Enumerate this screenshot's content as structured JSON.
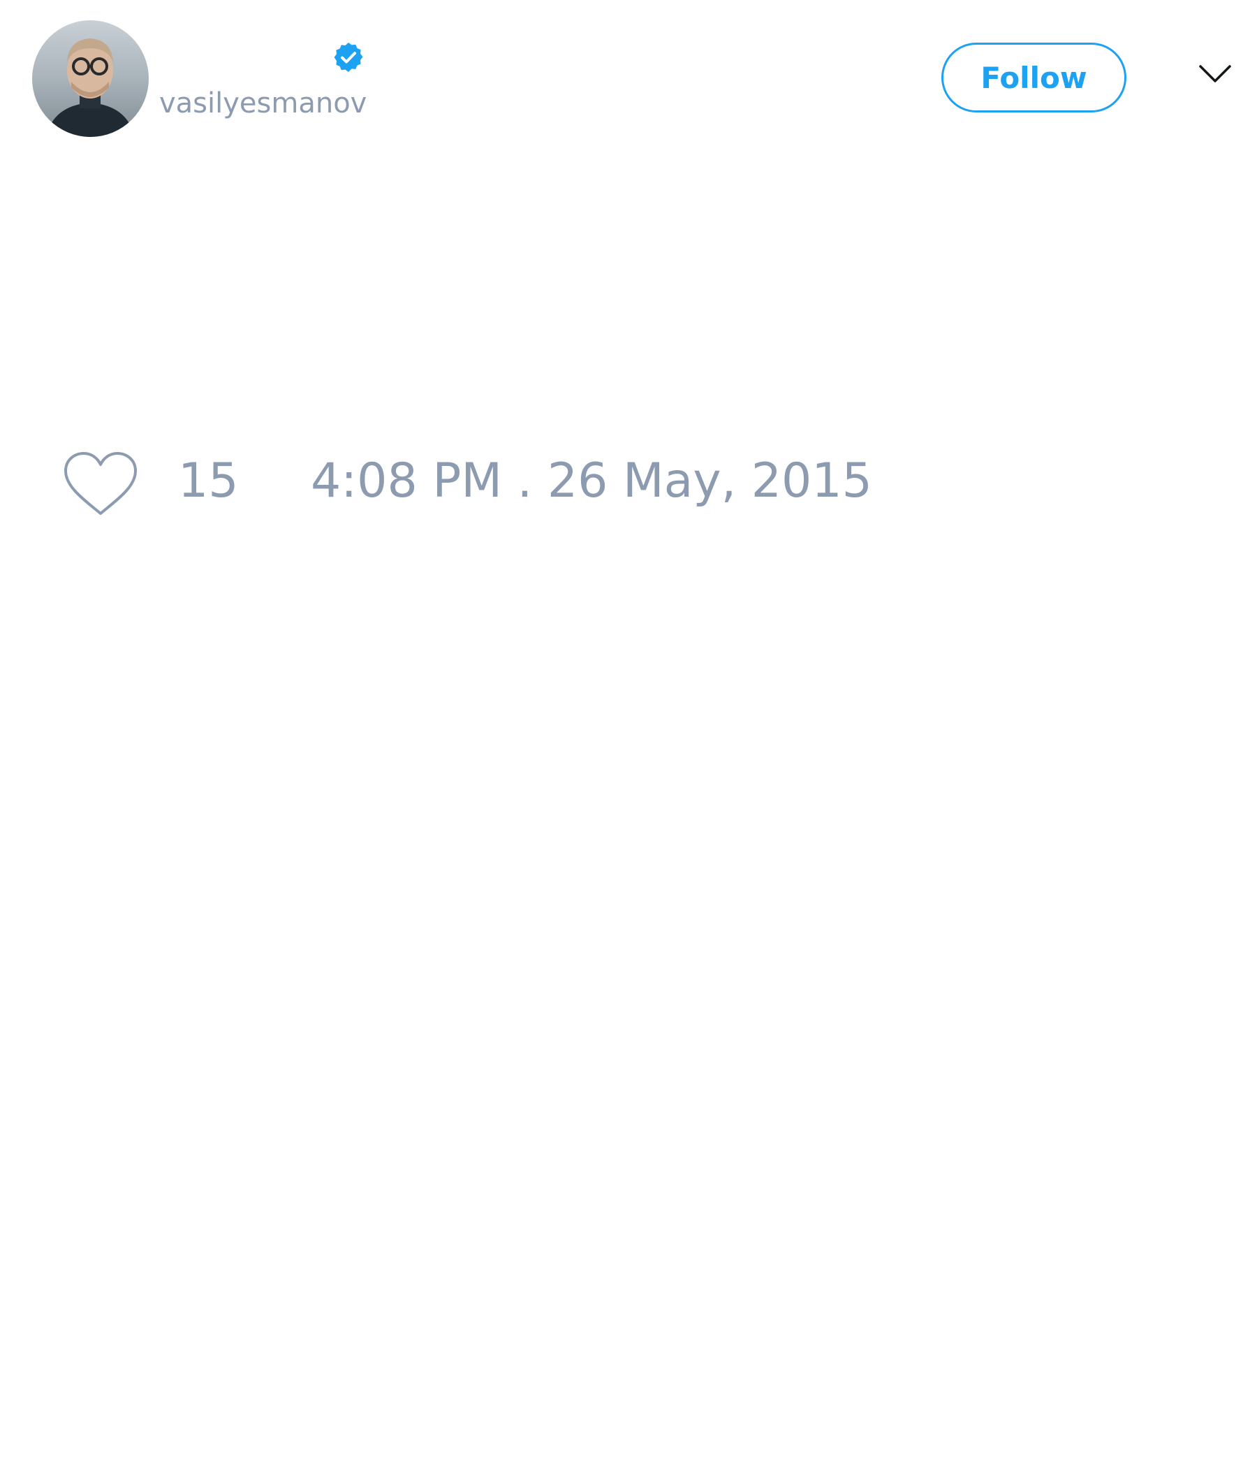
{
  "tweet": {
    "author": {
      "handle": "vasilyesmanov",
      "verified": true,
      "avatar_icon": "user-avatar-photo"
    },
    "follow_button_label": "Follow",
    "menu_icon": "chevron-down-icon",
    "like_icon": "heart-outline-icon",
    "like_count": "15",
    "timestamp": "4:08 PM . 26 May, 2015"
  },
  "colors": {
    "accent": "#1da1f2",
    "muted_text": "#8d9bb0",
    "background": "#ffffff"
  }
}
